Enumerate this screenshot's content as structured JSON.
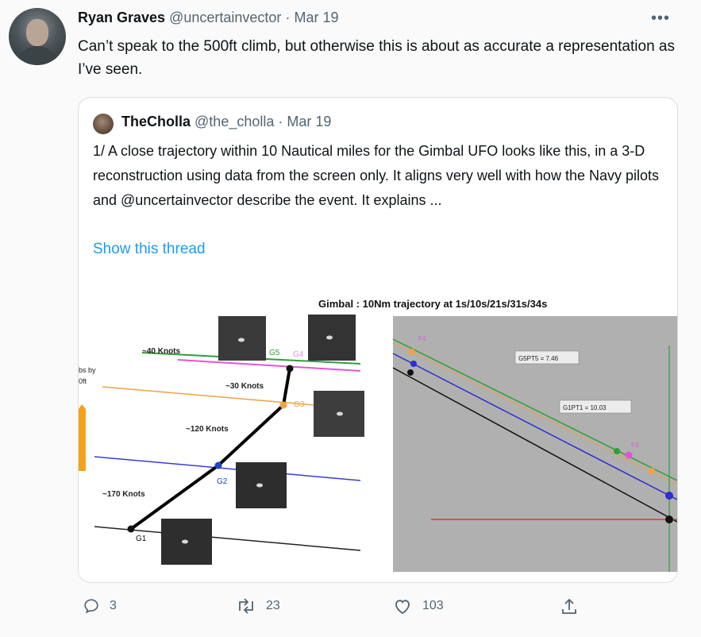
{
  "tweet": {
    "author_name": "Ryan Graves",
    "handle": "@uncertainvector",
    "separator": "·",
    "date": "Mar 19",
    "text": "Can’t speak to the 500ft climb, but otherwise this is about as accurate a representation as I’ve seen."
  },
  "quoted": {
    "author_name": "TheCholla",
    "handle": "@the_cholla",
    "separator": "·",
    "date": "Mar 19",
    "text": "1/ A close trajectory within 10 Nautical miles for the Gimbal UFO looks like this, in a 3-D reconstruction using data from the screen only. It aligns very well with how the Navy pilots and @uncertainvector describe the event. It explains ...",
    "show_thread": "Show this thread"
  },
  "figure": {
    "title": "Gimbal : 10Nm trajectory at 1s/10s/21s/31s/34s",
    "left_labels": {
      "k40": "~40 Knots",
      "k30": "~30 Knots",
      "k120": "~120 Knots",
      "k170": "~170 Knots",
      "g1": "G1",
      "g2": "G2",
      "g3": "G3",
      "g4": "G4",
      "g5": "G5",
      "edge1": "bs by",
      "edge2": "0ft"
    },
    "right_labels": {
      "g5pt5": "G5PT5 = 7.46",
      "g1pt1": "G1PT1 = 10.03",
      "f4": "F4",
      "f3": "F3"
    }
  },
  "actions": {
    "replies": "3",
    "retweets": "23",
    "likes": "103"
  },
  "colors": {
    "link": "#1d9bf0",
    "muted": "#536471",
    "border": "#d9dde0"
  }
}
